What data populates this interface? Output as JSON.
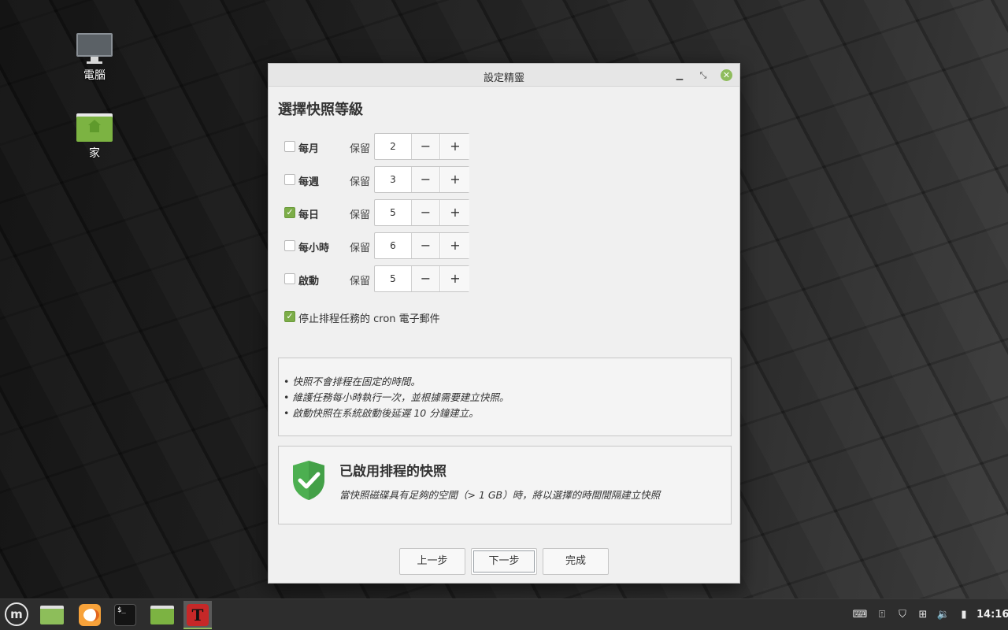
{
  "desktop": {
    "icons": [
      {
        "label": "電腦"
      },
      {
        "label": "家"
      }
    ]
  },
  "window": {
    "title": "設定精靈",
    "heading": "選擇快照等級",
    "keep_label": "保留",
    "levels": [
      {
        "name": "每月",
        "checked": false,
        "value": "2"
      },
      {
        "name": "每週",
        "checked": false,
        "value": "3"
      },
      {
        "name": "每日",
        "checked": true,
        "value": "5"
      },
      {
        "name": "每小時",
        "checked": false,
        "value": "6"
      },
      {
        "name": "啟動",
        "checked": false,
        "value": "5"
      }
    ],
    "minus": "−",
    "plus": "+",
    "cron_label": "停止排程任務的 cron 電子郵件",
    "cron_checked": true,
    "notes": [
      "• 快照不會排程在固定的時間。",
      "• 維護任務每小時執行一次，並根據需要建立快照。",
      "• 啟動快照在系統啟動後延遲 10 分鐘建立。"
    ],
    "status": {
      "title": "已啟用排程的快照",
      "description": "當快照磁碟具有足夠的空間（> 1 GB）時，將以選擇的時間間隔建立快照"
    },
    "buttons": {
      "prev": "上一步",
      "next": "下一步",
      "done": "完成"
    }
  },
  "taskbar": {
    "clock": "14:16",
    "accent": "#8fbc5c"
  }
}
